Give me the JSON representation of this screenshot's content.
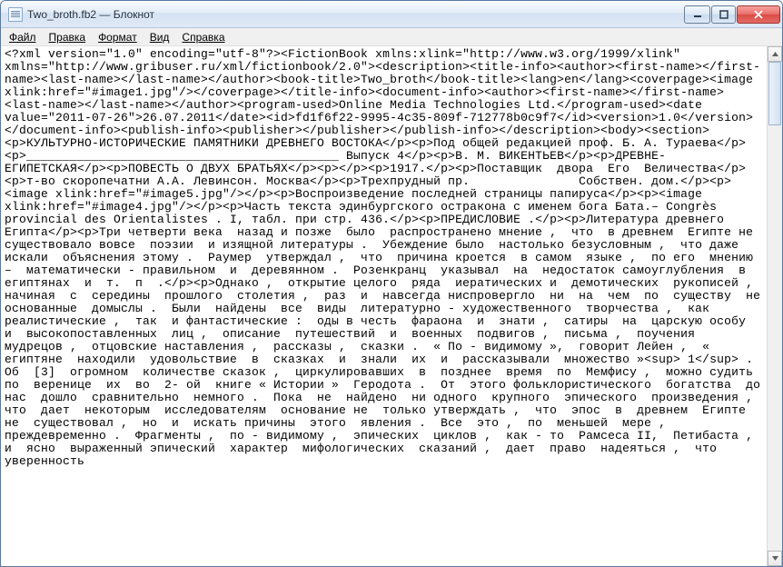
{
  "window": {
    "title": "Two_broth.fb2 — Блокнот"
  },
  "menu": {
    "file": "Файл",
    "edit": "Правка",
    "format": "Формат",
    "view": "Вид",
    "help": "Справка"
  },
  "content": "<?xml version=\"1.0\" encoding=\"utf-8\"?><FictionBook xmlns:xlink=\"http://www.w3.org/1999/xlink\" xmlns=\"http://www.gribuser.ru/xml/fictionbook/2.0\"><description><title-info><author><first-name></first-name><last-name></last-name></author><book-title>Two_broth</book-title><lang>en</lang><coverpage><image xlink:href=\"#image1.jpg\"/></coverpage></title-info><document-info><author><first-name></first-name><last-name></last-name></author><program-used>Online Media Technologies Ltd.</program-used><date value=\"2011-07-26\">26.07.2011</date><id>fd1f6f22-9995-4c35-809f-712778b0c9f7</id><version>1.0</version></document-info><publish-info><publisher></publisher></publish-info></description><body><section><p>КУЛЬТУРНО-ИСТОРИЧЕСКИЕ ПАМЯТНИКИ ДРЕВНЕГО ВОСТОКА</p><p>Под общей редакцией проф. Б. А. Тураева</p><p>___________________________________________ Выпуск 4</p><p>В. М. ВИКЕНТЬЕВ</p><p>ДРЕВНЕ-ЕГИПЕТСКАЯ</p><p>ПОВЕСТЬ О ДВУХ БРАТЬЯХ</p><p></p><p>1917.</p><p>Поставщик  двора  Его  Величества</p><p>т-во скоропечатни А.А. Левинсон. Москва</p><p>Трехпрудный пр.               Собствен. дом.</p><p><image xlink:href=\"#image5.jpg\"/></p><p>Воспроизведение последней страницы папируса</p><p><image xlink:href=\"#image4.jpg\"/></p><p>Часть текста эдинбургского остракона с именем бога Бата.– Congrès provincial des Orientalistes . I, табл. при стр. 436.</p><p>ПРЕДИСЛОВИЕ .</p><p>Литература древнего Египта</p><p>Три четверти века  назад и позже  было  распространено мнение ,  что  в древнем  Египте не  существовало вовсе  поэзии  и изящной литературы .  Убеждение было  настолько безусловным ,  что даже искали  объяснения этому .  Раумер  утверждал ,  что  причина кроется  в самом  языке ,  по его  мнению  –  математически - правильном  и  деревянном .  Розенкранц  указывал  на  недостаток самоуглубления  в  египтянах  и  т.  п  .</p><p>Однако ,  открытие целого  ряда  иератических и  демотических  рукописей ,  начиная  с  середины  прошлого  столетия ,  раз  и  навсегда ниспровергло  ни  на  чем  по  существу  не  основанные  домыслы .  Были  найдены  все  виды  литературно - художественного  творчества ,  как  реалистические ,  так  и фантастические :  оды в честь  фараона  и  знати ,  сатиры  на  царскую особу  и  высокопоставленных  лиц ,  описание  путешествий  и  военных  подвигов ,  письма ,  поучения  мудрецов ,  отцовские наставления ,  рассказы ,  сказки .  « По - видимому »,  говорит Лейен ,  « египтяне  находили  удовольствие  в  сказках  и  знали  их  и  рассказывали  множество »<sup> 1</sup> . Об  [3]  огромном  количестве сказок ,  циркулировавших  в  позднее  время  по  Мемфису ,  можно судить  по  веренице  их  во  2- ой  книге « Истории »  Геродота .  От  этого фольклористического  богатства  до  нас  дошло  сравнительно  немного .  Пока  не  найдено  ни одного  крупного  эпического  произведения ,  что  дает  некоторым  исследователям  основание не  только утверждать ,  что  эпос  в  древнем  Египте  не  существовал ,  но  и  искать причины  этого  явления .  Все  это ,  по  меньшей  мере ,  преждевременно .  Фрагменты ,  по - видимому ,  эпических  циклов ,  как - то  Рамсеса II,  Петибаста ,  и  ясно  выраженный эпический  характер  мифологических  сказаний ,  дает  право  надеяться ,  что  уверенность"
}
